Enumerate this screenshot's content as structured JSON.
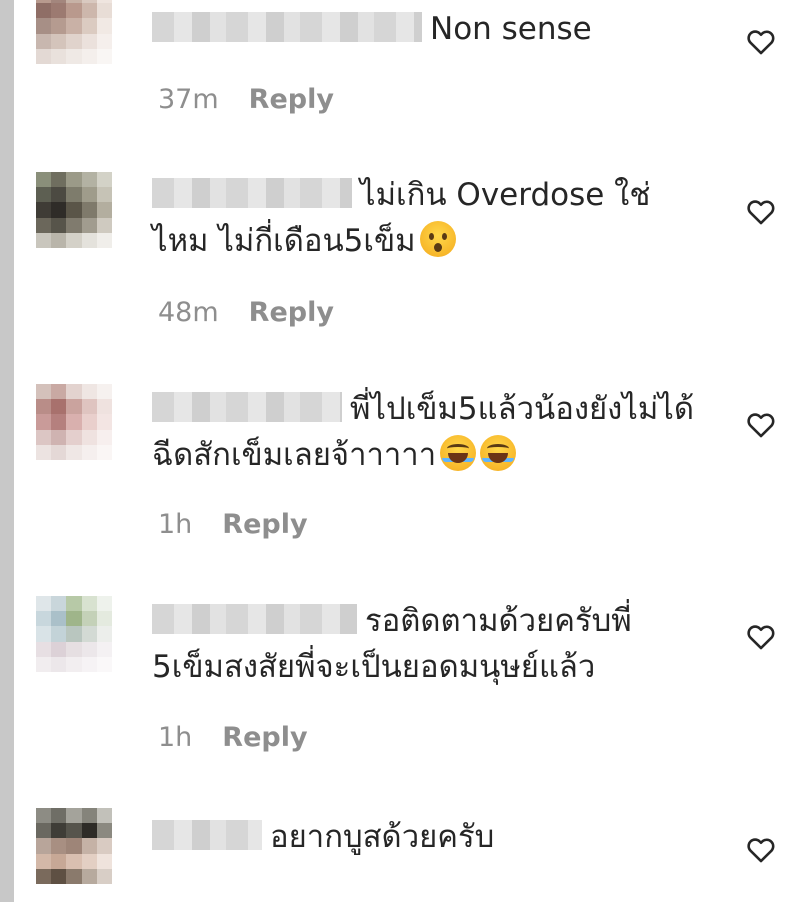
{
  "comments": [
    {
      "text_line1": "Non sense",
      "text_line2": "",
      "time": "37m",
      "reply_label": "Reply",
      "emojis": [],
      "avatar_colors": [
        "#b89a8e",
        "#a3867d",
        "#c7b2a6",
        "#d9c9c0",
        "#efe5df",
        "#8f6e66",
        "#9c7a71",
        "#b9998d",
        "#cdb7ac",
        "#e8ddd6",
        "#a78f86",
        "#b59b90",
        "#c9b1a6",
        "#dbcbc1",
        "#f1e9e4",
        "#c8b7af",
        "#d4c4bb",
        "#e0d3cc",
        "#ebe1dc",
        "#f5efec",
        "#e3d9d4",
        "#e9e1dc",
        "#efe9e5",
        "#f4efec",
        "#f9f6f4"
      ],
      "username_width": 270
    },
    {
      "text_line1": "ไม่เกิน Overdose ใช่",
      "text_line2": "ไหม ไม่กี่เดือน5เข็ม",
      "time": "48m",
      "reply_label": "Reply",
      "emojis": [
        "shock"
      ],
      "avatar_colors": [
        "#8a8f7a",
        "#6f6e5f",
        "#9b9a88",
        "#b3b2a3",
        "#d3d2c7",
        "#5d5f52",
        "#4c4a42",
        "#7e7c6c",
        "#9f9c8b",
        "#c6c3b6",
        "#3f3c36",
        "#2f2c28",
        "#5a5548",
        "#7f7a6b",
        "#b3ae9f",
        "#6b675b",
        "#57544a",
        "#807b6e",
        "#a19c8f",
        "#cfcac0",
        "#c9c6bd",
        "#b9b5aa",
        "#d4d1c8",
        "#e4e2dc",
        "#f0eeea"
      ],
      "username_width": 200
    },
    {
      "text_line1": "พี่ไปเข็ม5แล้วน้องยังไม่ได้",
      "text_line2": "ฉีดสักเข็มเลยจ้าาาาา",
      "time": "1h",
      "reply_label": "Reply",
      "emojis": [
        "laugh",
        "laugh"
      ],
      "avatar_colors": [
        "#d4c1bb",
        "#c9a9a3",
        "#e3d3cf",
        "#efe6e3",
        "#f6f1ef",
        "#b98d88",
        "#a8716d",
        "#caa39e",
        "#dfc4c0",
        "#efe2df",
        "#c99b99",
        "#b5807e",
        "#d9b0ae",
        "#e9cfcc",
        "#f3e5e3",
        "#dcc6c4",
        "#cfb3b1",
        "#e4cfcd",
        "#efe2e0",
        "#f7efee",
        "#ece3e1",
        "#e4d8d6",
        "#efe7e5",
        "#f5efee",
        "#faf6f5"
      ],
      "username_width": 190
    },
    {
      "text_line1": "รอติดตามด้วยครับพี่",
      "text_line2": "5เข็มสงสัยพี่จะเป็นยอดมนุษย์แล้ว",
      "time": "1h",
      "reply_label": "Reply",
      "emojis": [],
      "avatar_colors": [
        "#dfe6e9",
        "#c9d6db",
        "#b7c9a7",
        "#d8e2d0",
        "#eef2ec",
        "#c8d7dd",
        "#aac0c9",
        "#9fb58a",
        "#c4d1b8",
        "#e4eadf",
        "#d9e3e7",
        "#c3d3d8",
        "#b9c6bf",
        "#d3dad4",
        "#eceeeb",
        "#e7dfe3",
        "#dcd1d7",
        "#e6dfe2",
        "#ece7ea",
        "#f4f1f3",
        "#f1edef",
        "#ece7ea",
        "#f2eef0",
        "#f6f3f5",
        "#faf8f9"
      ],
      "username_width": 205
    },
    {
      "text_line1": "อยากบูสด้วยครับ",
      "text_line2": "",
      "time": "",
      "reply_label": "",
      "emojis": [],
      "avatar_colors": [
        "#8d8c84",
        "#6f6e66",
        "#a4a39b",
        "#85847b",
        "#c2c1ba",
        "#6a6860",
        "#3f3d37",
        "#56544c",
        "#2e2c27",
        "#8b8980",
        "#b8a59a",
        "#a88f82",
        "#9e8578",
        "#c5b2a6",
        "#d9cbc2",
        "#d3b8a8",
        "#c7a896",
        "#d9bfb0",
        "#e3cfc3",
        "#efe3dc",
        "#7a6a5c",
        "#5e5043",
        "#8a7a6c",
        "#b7aa9e",
        "#d8cec6"
      ],
      "username_width": 110
    }
  ]
}
